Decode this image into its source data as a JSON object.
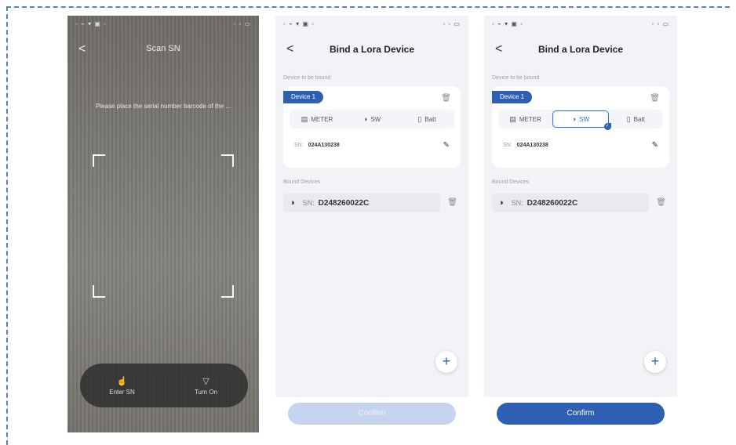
{
  "screen1": {
    "title": "Scan SN",
    "back": "<",
    "hint": "Please place the serial number barcode of the ...",
    "enter_sn": "Enter SN",
    "turn_on": "Turn On",
    "enter_icon": "hand-icon",
    "torch_icon": "flashlight-icon"
  },
  "screen2": {
    "title": "Bind a Lora Device",
    "back": "<",
    "section_to_bind": "Device to be bound",
    "device_label": "Device 1",
    "types": [
      "METER",
      "SW",
      "Batt"
    ],
    "sn_label": "SN:",
    "sn_value": "024A130238",
    "section_bound": "Bound Devices",
    "stored_sn_label": "SN:",
    "stored_sn": "D248260022C",
    "add": "+",
    "confirm": "Confirm"
  },
  "screen3": {
    "title": "Bind a Lora Device",
    "back": "<",
    "section_to_bind": "Device to be bound",
    "device_label": "Device 1",
    "types": [
      "METER",
      "SW",
      "Batt"
    ],
    "selected_type": "SW",
    "sn_label": "SN:",
    "sn_value": "024A130238",
    "section_bound": "Bound Devices",
    "stored_sn_label": "SN:",
    "stored_sn": "D248260022C",
    "add": "+",
    "confirm": "Confirm"
  },
  "colors": {
    "accent": "#2f5fb3",
    "dashed_border": "#4a86c5",
    "disabled_button": "#c7d4ef"
  }
}
